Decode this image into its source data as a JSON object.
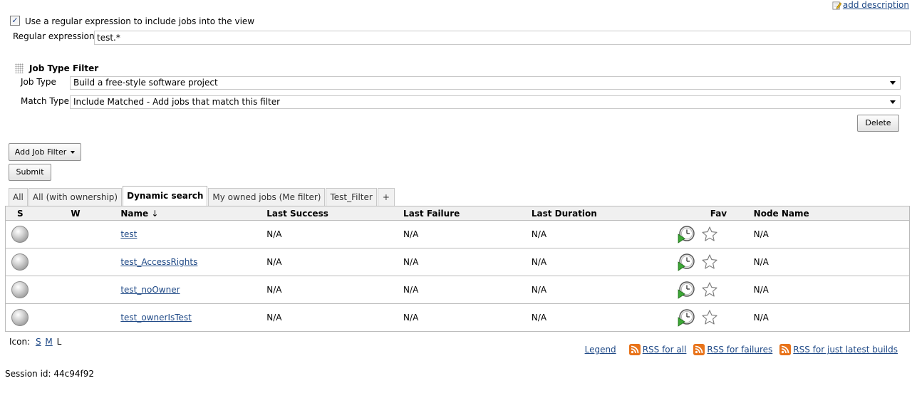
{
  "header": {
    "add_description": "add description"
  },
  "regex": {
    "checkbox_label": "Use a regular expression to include jobs into the view",
    "checked": true,
    "field_label": "Regular expression",
    "value": "test.*"
  },
  "job_type_filter": {
    "title": "Job Type Filter",
    "job_type_label": "Job Type",
    "job_type_value": "Build a free-style software project",
    "match_type_label": "Match Type",
    "match_type_value": "Include Matched - Add jobs that match this filter",
    "delete_label": "Delete"
  },
  "buttons": {
    "add_job_filter": "Add Job Filter",
    "submit": "Submit"
  },
  "tabs": [
    {
      "label": "All"
    },
    {
      "label": "All (with ownership)"
    },
    {
      "label": "Dynamic search",
      "active": true
    },
    {
      "label": "My owned jobs (Me filter)"
    },
    {
      "label": "Test_Filter"
    },
    {
      "label": "+"
    }
  ],
  "table": {
    "columns": {
      "s": "S",
      "w": "W",
      "name": "Name",
      "sort_indicator": "↓",
      "last_success": "Last Success",
      "last_failure": "Last Failure",
      "last_duration": "Last Duration",
      "fav": "Fav",
      "node_name": "Node Name"
    },
    "rows": [
      {
        "name": "test",
        "last_success": "N/A",
        "last_failure": "N/A",
        "last_duration": "N/A",
        "node_name": "N/A"
      },
      {
        "name": "test_AccessRights",
        "last_success": "N/A",
        "last_failure": "N/A",
        "last_duration": "N/A",
        "node_name": "N/A"
      },
      {
        "name": "test_noOwner",
        "last_success": "N/A",
        "last_failure": "N/A",
        "last_duration": "N/A",
        "node_name": "N/A"
      },
      {
        "name": "test_ownerIsTest",
        "last_success": "N/A",
        "last_failure": "N/A",
        "last_duration": "N/A",
        "node_name": "N/A"
      }
    ]
  },
  "icon_size": {
    "label": "Icon:",
    "small": "S",
    "medium": "M",
    "large": "L"
  },
  "footer": {
    "legend": "Legend",
    "rss_all": "RSS for all",
    "rss_failures": "RSS for failures",
    "rss_latest": "RSS for just latest builds",
    "session": "Session id: 44c94f92"
  },
  "colors": {
    "link": "#204a87",
    "rss": "#e8731a",
    "header_bg": "#f0f0f0"
  }
}
